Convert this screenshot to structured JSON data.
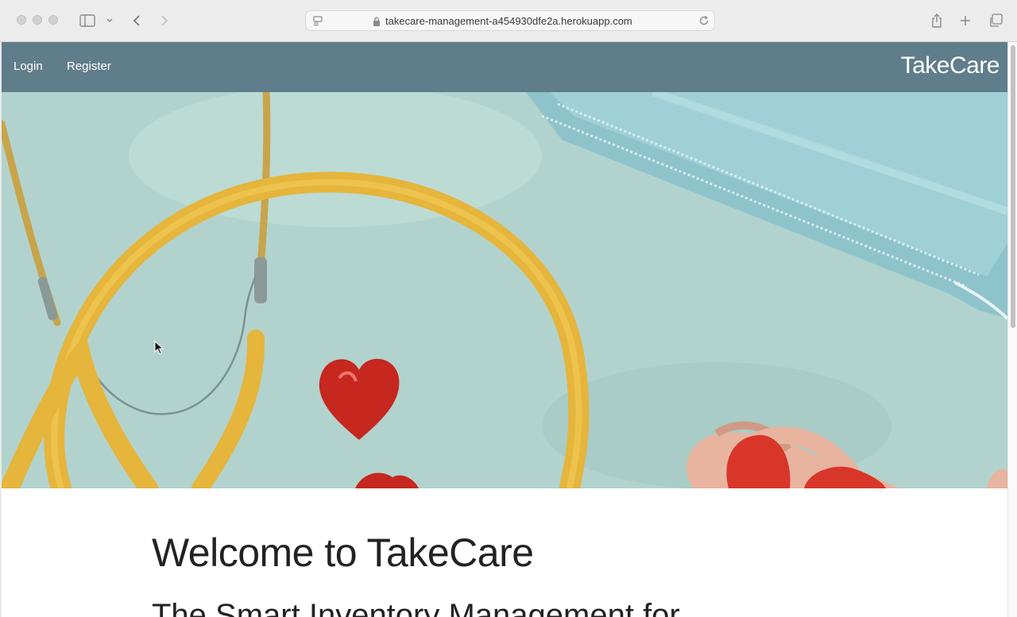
{
  "browser": {
    "url": "takecare-management-a454930dfe2a.herokuapp.com"
  },
  "nav": {
    "login_label": "Login",
    "register_label": "Register",
    "brand": "TakeCare"
  },
  "content": {
    "title": "Welcome to TakeCare",
    "subtitle": "The Smart Inventory Management for"
  },
  "colors": {
    "navbar": "#607d8b",
    "hero_background": "#b2d3cd"
  }
}
